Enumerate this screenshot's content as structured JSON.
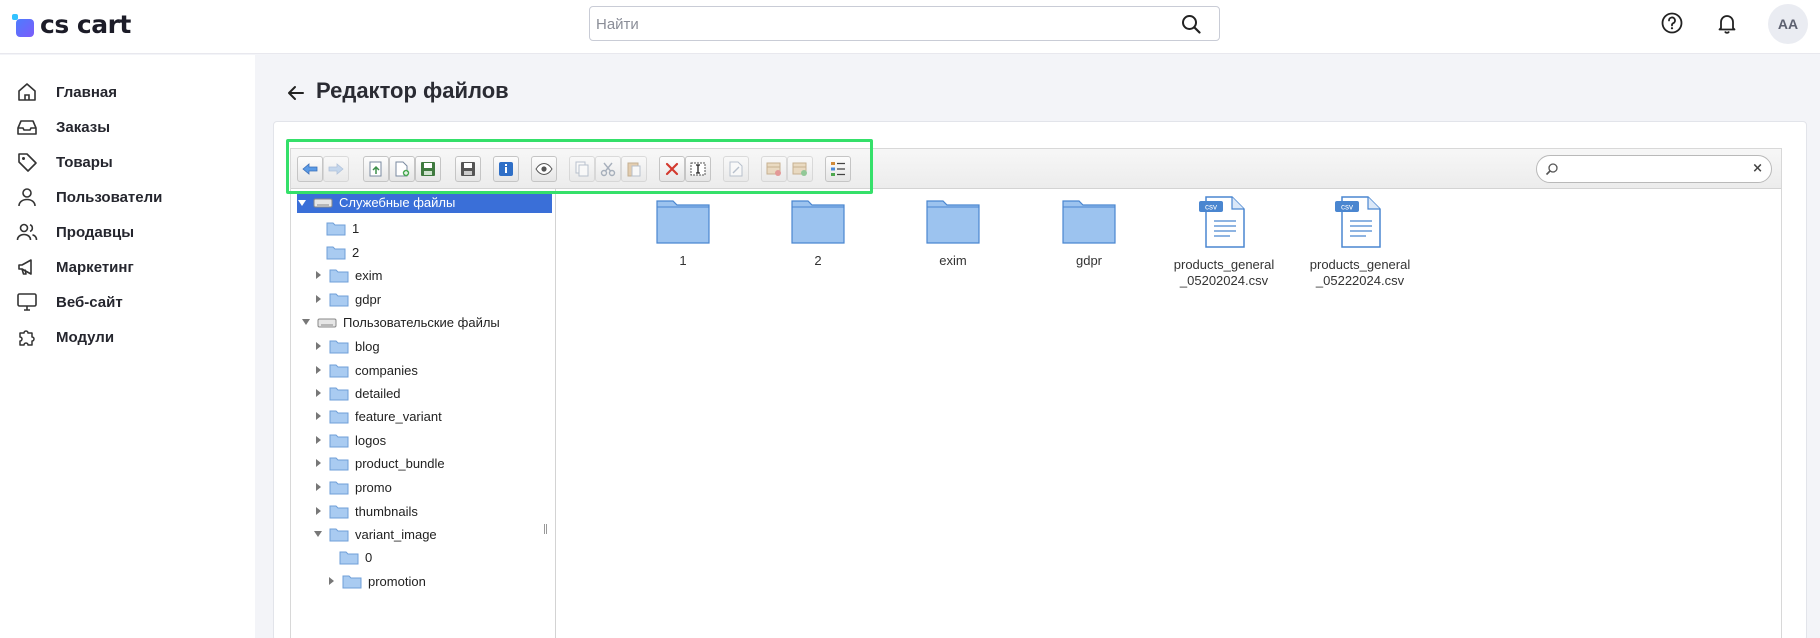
{
  "app": {
    "logo_text": "cs cart"
  },
  "header": {
    "search_placeholder": "Найти",
    "avatar_initials": "AA"
  },
  "sidebar": {
    "items": [
      {
        "label": "Главная",
        "icon": "home-icon"
      },
      {
        "label": "Заказы",
        "icon": "inbox-icon"
      },
      {
        "label": "Товары",
        "icon": "tag-icon"
      },
      {
        "label": "Пользователи",
        "icon": "user-icon"
      },
      {
        "label": "Продавцы",
        "icon": "users-icon"
      },
      {
        "label": "Маркетинг",
        "icon": "megaphone-icon"
      },
      {
        "label": "Веб-сайт",
        "icon": "monitor-icon"
      },
      {
        "label": "Модули",
        "icon": "puzzle-icon"
      }
    ]
  },
  "page": {
    "title": "Редактор файлов"
  },
  "tree": {
    "nodes": [
      {
        "label": "Служебные файлы",
        "type": "drive",
        "selected": true
      },
      {
        "label": "1",
        "type": "folder"
      },
      {
        "label": "2",
        "type": "folder"
      },
      {
        "label": "exim",
        "type": "folder"
      },
      {
        "label": "gdpr",
        "type": "folder"
      },
      {
        "label": "Пользовательские файлы",
        "type": "drive"
      },
      {
        "label": "blog",
        "type": "folder"
      },
      {
        "label": "companies",
        "type": "folder"
      },
      {
        "label": "detailed",
        "type": "folder"
      },
      {
        "label": "feature_variant",
        "type": "folder"
      },
      {
        "label": "logos",
        "type": "folder"
      },
      {
        "label": "product_bundle",
        "type": "folder"
      },
      {
        "label": "promo",
        "type": "folder"
      },
      {
        "label": "thumbnails",
        "type": "folder"
      },
      {
        "label": "variant_image",
        "type": "folder"
      },
      {
        "label": "0",
        "type": "folder"
      },
      {
        "label": "promotion",
        "type": "folder"
      }
    ]
  },
  "files": [
    {
      "name": "1",
      "type": "folder"
    },
    {
      "name": "2",
      "type": "folder"
    },
    {
      "name": "exim",
      "type": "folder"
    },
    {
      "name": "gdpr",
      "type": "folder"
    },
    {
      "name_line1": "products_general",
      "name_line2": "_05202024.csv",
      "type": "csv",
      "badge": "csv"
    },
    {
      "name_line1": "products_general",
      "name_line2": "_05222024.csv",
      "type": "csv",
      "badge": "csv"
    }
  ],
  "colors": {
    "selected": "#3a6fd8",
    "highlight": "#35e06a",
    "folder": "#8fb9ec"
  }
}
